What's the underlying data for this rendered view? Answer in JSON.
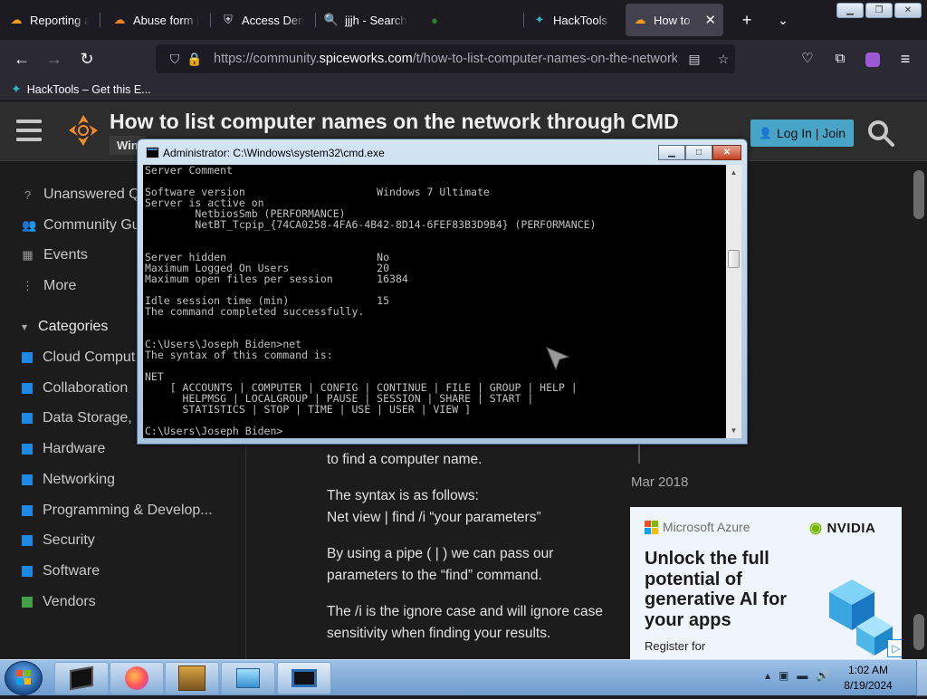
{
  "browser": {
    "tabs": [
      {
        "title": "Reporting abu",
        "icon": "spiceworks-icon"
      },
      {
        "title": "Abuse form |",
        "icon": "cloudflare-icon"
      },
      {
        "title": "Access Denie",
        "icon": "shield-icon"
      },
      {
        "title": "jjjh - Search",
        "icon": "search-icon"
      },
      {
        "title": "",
        "icon": "generic-icon"
      },
      {
        "title": "HackTools – G",
        "icon": "hacktools-icon"
      },
      {
        "title": "How to list",
        "icon": "spiceworks-icon",
        "active": true
      }
    ],
    "url_prefix": "https://community.",
    "url_host": "spiceworks.com",
    "url_rest": "/t/how-to-list-computer-names-on-the-network-",
    "bookmark": "HackTools – Get this E..."
  },
  "site": {
    "topic_title": "How to list computer names on the network through CMD",
    "category_chip": "Win",
    "login_label": "Log In | Join",
    "sidebar": {
      "top_items": [
        {
          "label": "Unanswered Q",
          "icon": "question-icon"
        },
        {
          "label": "Community Gu",
          "icon": "people-icon"
        },
        {
          "label": "Events",
          "icon": "calendar-icon"
        },
        {
          "label": "More",
          "icon": "more-icon"
        }
      ],
      "categories_heading": "Categories",
      "categories": [
        {
          "label": "Cloud Comput",
          "color": "#1e88e5"
        },
        {
          "label": "Collaboration",
          "color": "#1e88e5"
        },
        {
          "label": "Data Storage, E",
          "color": "#1e88e5"
        },
        {
          "label": "Hardware",
          "color": "#1e88e5"
        },
        {
          "label": "Networking",
          "color": "#1e88e5"
        },
        {
          "label": "Programming & Develop...",
          "color": "#1e88e5"
        },
        {
          "label": "Security",
          "color": "#1e88e5"
        },
        {
          "label": "Software",
          "color": "#1e88e5"
        },
        {
          "label": "Vendors",
          "color": "#43a047"
        }
      ]
    },
    "post": {
      "p0": "to find a computer name.",
      "p1a": "The syntax is as follows:",
      "p1b": "Net view | find /i “your parameters”",
      "p2": "By using a pipe ( | ) we can pass our parameters to the “find” command.",
      "p3": "The /i is the ignore case and will ignore case sensitivity when finding your results."
    },
    "timeline_date": "Mar 2018",
    "ad": {
      "microsoft": "Microsoft Azure",
      "nvidia": "NVIDIA",
      "headline": "Unlock the full potential of generative AI for your apps",
      "cta": "Register for"
    }
  },
  "cmd": {
    "title": "Administrator: C:\\Windows\\system32\\cmd.exe",
    "lines": [
      "Server Comment",
      "",
      "Software version                     Windows 7 Ultimate",
      "Server is active on",
      "        NetbiosSmb (PERFORMANCE)",
      "        NetBT_Tcpip_{74CA0258-4FA6-4B42-8D14-6FEF83B3D9B4} (PERFORMANCE)",
      "",
      "",
      "Server hidden                        No",
      "Maximum Logged On Users              20",
      "Maximum open files per session       16384",
      "",
      "Idle session time (min)              15",
      "The command completed successfully.",
      "",
      "",
      "C:\\Users\\Joseph Biden>net",
      "The syntax of this command is:",
      "",
      "NET",
      "    [ ACCOUNTS | COMPUTER | CONFIG | CONTINUE | FILE | GROUP | HELP |",
      "      HELPMSG | LOCALGROUP | PAUSE | SESSION | SHARE | START |",
      "      STATISTICS | STOP | TIME | USE | USER | VIEW ]",
      "",
      "C:\\Users\\Joseph Biden>"
    ]
  },
  "taskbar": {
    "time": "1:02 AM",
    "date": "8/19/2024",
    "apps": [
      "cmd-app",
      "firefox-app",
      "box-app",
      "monitor-app",
      "terminal-app"
    ]
  }
}
